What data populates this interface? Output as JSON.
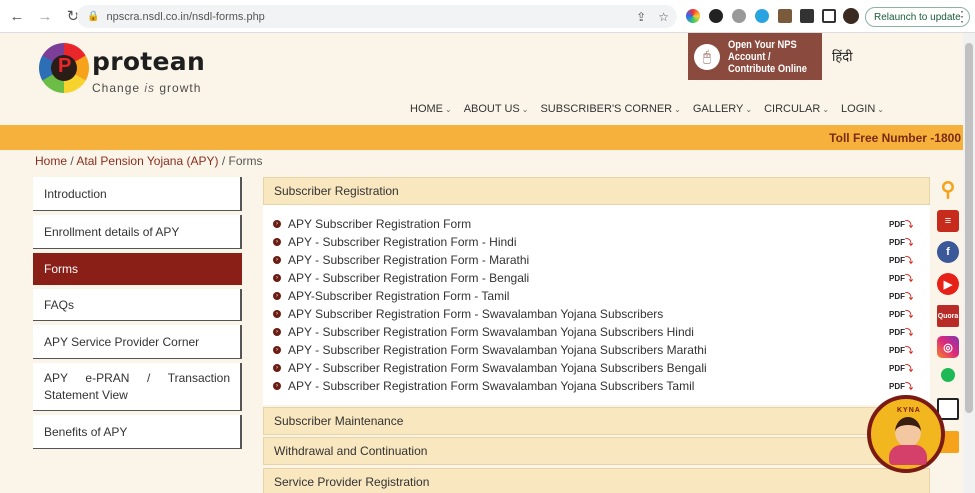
{
  "browser": {
    "url": "npscra.nsdl.co.in/nsdl-forms.php",
    "relaunch_label": "Relaunch to update"
  },
  "header": {
    "brand": "protean",
    "tagline_pre": "Change ",
    "tagline_em": "is",
    "tagline_post": " growth",
    "nps_button": "Open Your NPS Account / Contribute Online",
    "language": "हिंदी",
    "nav": [
      "HOME",
      "ABOUT US",
      "SUBSCRIBER'S CORNER",
      "GALLERY",
      "CIRCULAR",
      "LOGIN"
    ],
    "toll_free": "Toll Free Number -1800"
  },
  "breadcrumb": {
    "home": "Home",
    "section": "Atal Pension Yojana (APY)",
    "current": "Forms"
  },
  "sidebar": {
    "items": [
      {
        "label": "Introduction"
      },
      {
        "label": "Enrollment details of APY"
      },
      {
        "label": "Forms"
      },
      {
        "label": "FAQs"
      },
      {
        "label": "APY Service Provider Corner"
      },
      {
        "label": "APY e-PRAN / Transaction Statement View"
      },
      {
        "label": "Benefits of APY"
      }
    ]
  },
  "sections": [
    {
      "title": "Subscriber Registration"
    },
    {
      "title": "Subscriber Maintenance"
    },
    {
      "title": "Withdrawal and Continuation"
    },
    {
      "title": "Service Provider Registration"
    }
  ],
  "forms": [
    "APY Subscriber Registration Form",
    "APY - Subscriber Registration Form - Hindi",
    "APY - Subscriber Registration Form - Marathi",
    "APY - Subscriber Registration Form - Bengali",
    "APY-Subscriber Registration Form - Tamil",
    "APY Subscriber Registration Form - Swavalamban Yojana Subscribers",
    "APY - Subscriber Registration Form Swavalamban Yojana Subscribers Hindi",
    "APY - Subscriber Registration Form Swavalamban Yojana Subscribers Marathi",
    "APY - Subscriber Registration Form Swavalamban Yojana Subscribers Bengali",
    "APY - Subscriber Registration Form Swavalamban Yojana Subscribers Tamil"
  ],
  "pdf_label": "PDF",
  "kyna_label": "KYNA",
  "social": {
    "quora": "Quora"
  },
  "colors": {
    "accent": "#8a1f17",
    "toll_bar": "#f6b13c",
    "section_header": "#f8e7bf"
  }
}
